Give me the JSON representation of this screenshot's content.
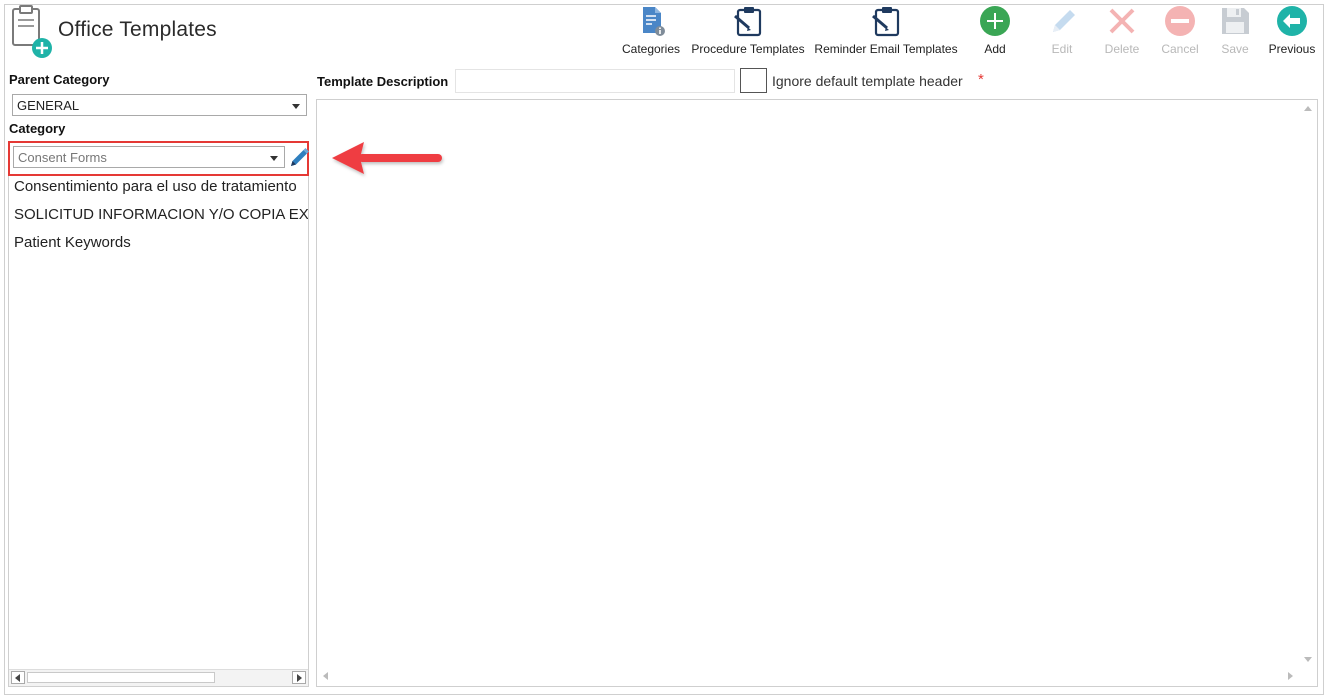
{
  "app": {
    "title": "Office Templates"
  },
  "toolbar": {
    "categories": "Categories",
    "procedure_templates": "Procedure Templates",
    "reminder_email_templates": "Reminder Email Templates",
    "add": "Add",
    "edit": "Edit",
    "delete": "Delete",
    "cancel": "Cancel",
    "save": "Save",
    "previous": "Previous"
  },
  "left": {
    "parent_category_label": "Parent Category",
    "parent_category_value": "GENERAL",
    "category_label": "Category",
    "category_value": "Consent Forms",
    "items": [
      "Consentimiento para el uso de tratamiento",
      "SOLICITUD INFORMACION Y/O COPIA EXPEDIENTE",
      "Patient Keywords"
    ]
  },
  "right": {
    "template_description_label": "Template Description",
    "template_description_value": "",
    "ignore_header_label": "Ignore default template header",
    "required_mark": "*"
  },
  "colors": {
    "accent_green": "#3aa655",
    "accent_teal": "#1fb3a8",
    "highlight_red": "#e53935",
    "navy": "#1f3a5f",
    "disabled": "#b8b8b8"
  },
  "icons": {
    "app": "clipboard-plus-icon",
    "categories": "document-info-icon",
    "procedure_templates": "clipboard-pen-icon",
    "reminder_email_templates": "clipboard-pen-icon",
    "add": "plus-circle-icon",
    "edit": "pencil-icon",
    "delete": "x-icon",
    "cancel": "minus-circle-icon",
    "save": "floppy-disk-icon",
    "previous": "arrow-left-circle-icon",
    "category_edit": "pencil-icon",
    "annotation": "red-arrow-left-icon"
  }
}
